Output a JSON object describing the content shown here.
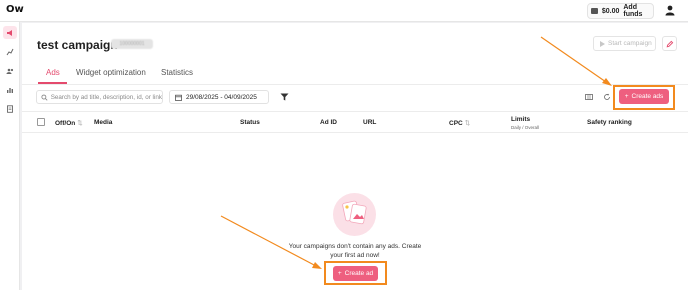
{
  "app": {
    "logo": "Ow"
  },
  "topbar": {
    "balance": "$0.00",
    "add_funds": "Add funds"
  },
  "sidebar": {
    "items": [
      "campaigns-icon",
      "publishers-icon",
      "audiences-icon",
      "reports-icon",
      "documents-icon"
    ]
  },
  "campaign": {
    "title": "test campaign",
    "id": "100000001",
    "start_label": "Start campaign"
  },
  "tabs": [
    {
      "label": "Ads"
    },
    {
      "label": "Widget optimization"
    },
    {
      "label": "Statistics"
    }
  ],
  "toolbar": {
    "search_placeholder": "Search by ad title, description, id, or link",
    "date_range": "29/08/2025 - 04/09/2025",
    "create_ads_label": "Create ads"
  },
  "table": {
    "columns": [
      "Off/On",
      "Media",
      "Status",
      "Ad ID",
      "URL",
      "CPC",
      "Limits",
      "Safety ranking"
    ],
    "limits_sub": "Daily / Overall"
  },
  "empty_state": {
    "message": "Your campaigns don't contain any ads. Create your first ad now!",
    "cta_label": "Create ad"
  },
  "colors": {
    "accent": "#ee5f7f",
    "highlight": "#f28a1e",
    "tab_active": "#e44a6d"
  }
}
